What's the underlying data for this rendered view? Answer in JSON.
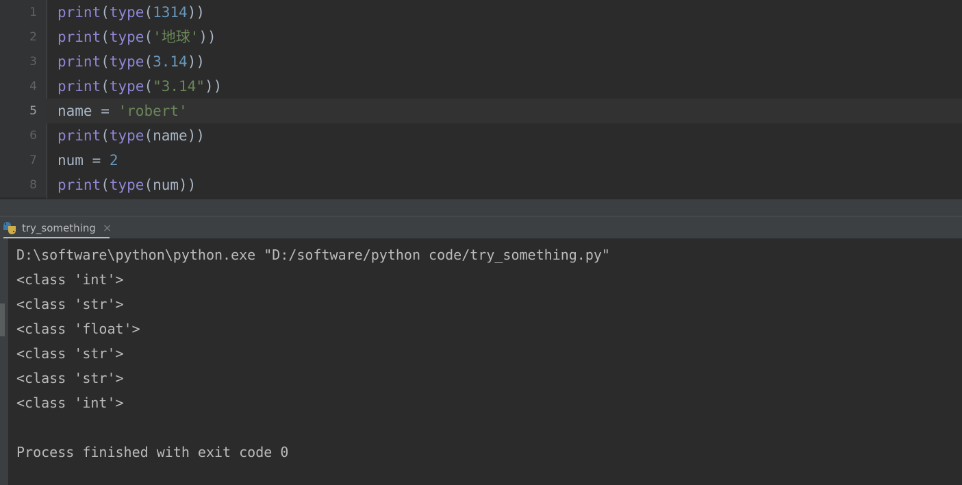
{
  "editor": {
    "lines": [
      {
        "number": "1",
        "active": false,
        "tokens": [
          {
            "t": "print",
            "c": "tok-fn"
          },
          {
            "t": "(",
            "c": "tok-punct"
          },
          {
            "t": "type",
            "c": "tok-fn"
          },
          {
            "t": "(",
            "c": "tok-punct"
          },
          {
            "t": "1314",
            "c": "tok-num"
          },
          {
            "t": "))",
            "c": "tok-punct"
          }
        ]
      },
      {
        "number": "2",
        "active": false,
        "tokens": [
          {
            "t": "print",
            "c": "tok-fn"
          },
          {
            "t": "(",
            "c": "tok-punct"
          },
          {
            "t": "type",
            "c": "tok-fn"
          },
          {
            "t": "(",
            "c": "tok-punct"
          },
          {
            "t": "'地球'",
            "c": "tok-str"
          },
          {
            "t": "))",
            "c": "tok-punct"
          }
        ]
      },
      {
        "number": "3",
        "active": false,
        "tokens": [
          {
            "t": "print",
            "c": "tok-fn"
          },
          {
            "t": "(",
            "c": "tok-punct"
          },
          {
            "t": "type",
            "c": "tok-fn"
          },
          {
            "t": "(",
            "c": "tok-punct"
          },
          {
            "t": "3.14",
            "c": "tok-num"
          },
          {
            "t": "))",
            "c": "tok-punct"
          }
        ]
      },
      {
        "number": "4",
        "active": false,
        "tokens": [
          {
            "t": "print",
            "c": "tok-fn"
          },
          {
            "t": "(",
            "c": "tok-punct"
          },
          {
            "t": "type",
            "c": "tok-fn"
          },
          {
            "t": "(",
            "c": "tok-punct"
          },
          {
            "t": "\"3.14\"",
            "c": "tok-str"
          },
          {
            "t": "))",
            "c": "tok-punct"
          }
        ]
      },
      {
        "number": "5",
        "active": true,
        "tokens": [
          {
            "t": "name",
            "c": "tok-var"
          },
          {
            "t": " = ",
            "c": "tok-op"
          },
          {
            "t": "'robert'",
            "c": "tok-str"
          }
        ]
      },
      {
        "number": "6",
        "active": false,
        "tokens": [
          {
            "t": "print",
            "c": "tok-fn"
          },
          {
            "t": "(",
            "c": "tok-punct"
          },
          {
            "t": "type",
            "c": "tok-fn"
          },
          {
            "t": "(",
            "c": "tok-punct"
          },
          {
            "t": "name",
            "c": "tok-var"
          },
          {
            "t": "))",
            "c": "tok-punct"
          }
        ]
      },
      {
        "number": "7",
        "active": false,
        "tokens": [
          {
            "t": "num",
            "c": "tok-var"
          },
          {
            "t": " = ",
            "c": "tok-op"
          },
          {
            "t": "2",
            "c": "tok-num"
          }
        ]
      },
      {
        "number": "8",
        "active": false,
        "tokens": [
          {
            "t": "print",
            "c": "tok-fn"
          },
          {
            "t": "(",
            "c": "tok-punct"
          },
          {
            "t": "type",
            "c": "tok-fn"
          },
          {
            "t": "(",
            "c": "tok-punct"
          },
          {
            "t": "num",
            "c": "tok-var"
          },
          {
            "t": "))",
            "c": "tok-punct"
          }
        ]
      }
    ]
  },
  "run_tab": {
    "label": "try_something",
    "close_glyph": "×",
    "icon": "python-file-icon"
  },
  "console": {
    "lines": [
      "D:\\software\\python\\python.exe \"D:/software/python code/try_something.py\"",
      "<class 'int'>",
      "<class 'str'>",
      "<class 'float'>",
      "<class 'str'>",
      "<class 'str'>",
      "<class 'int'>",
      "",
      "Process finished with exit code 0"
    ]
  },
  "colors": {
    "editor_bg": "#2b2b2b",
    "gutter_bg": "#313335",
    "active_line_bg": "#323232",
    "tab_bar_bg": "#3c4043",
    "splitter_bg": "#3c3f41",
    "console_text": "#bbbbbb",
    "keyword_fn": "#8f87d6",
    "number": "#6897bb",
    "string": "#6a8759",
    "default_text": "#a9b7c6"
  }
}
